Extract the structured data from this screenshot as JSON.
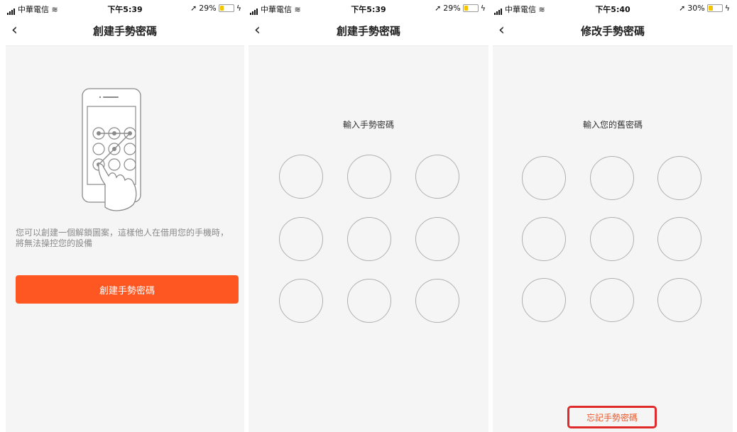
{
  "screens": [
    {
      "status": {
        "carrier": "中華電信",
        "time": "下午5:39",
        "battery": "29%"
      },
      "title": "創建手勢密碼",
      "description": "您可以創建一個解鎖圖案，這樣他人在借用您的手機時，將無法操控您的設備",
      "button_label": "創建手勢密碼"
    },
    {
      "status": {
        "carrier": "中華電信",
        "time": "下午5:39",
        "battery": "29%"
      },
      "title": "創建手勢密碼",
      "prompt": "輸入手勢密碼"
    },
    {
      "status": {
        "carrier": "中華電信",
        "time": "下午5:40",
        "battery": "30%"
      },
      "title": "修改手勢密碼",
      "prompt": "輸入您的舊密碼",
      "forgot_label": "忘記手勢密碼"
    }
  ],
  "icons": {
    "back": "back-chevron-icon",
    "signal": "signal-bars-icon",
    "wifi": "wifi-icon",
    "location": "location-arrow-icon",
    "battery": "battery-icon",
    "charging": "charging-bolt-icon"
  },
  "colors": {
    "accent": "#ff5722",
    "highlight_box": "#e02b2b",
    "forgot_text": "#e8582b",
    "background": "#f5f5f5"
  }
}
